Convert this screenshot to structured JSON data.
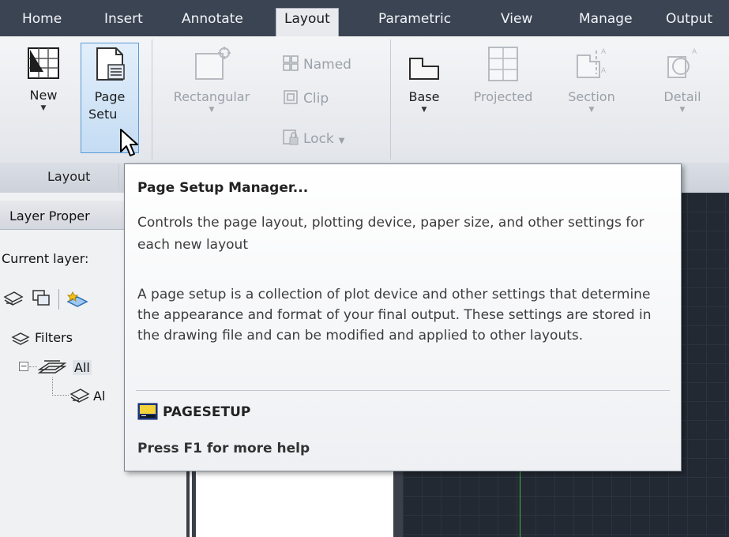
{
  "ribbon_tabs": [
    "Home",
    "Insert",
    "Annotate",
    "Layout",
    "Parametric",
    "View",
    "Manage",
    "Output"
  ],
  "active_tab": "Layout",
  "layout_panel": {
    "new_label": "New",
    "page_setup_label_1": "Page",
    "page_setup_label_2": "Setu",
    "panel_title": "Layout"
  },
  "viewport_panel": {
    "rectangular_label": "Rectangular",
    "named_label": "Named",
    "clip_label": "Clip",
    "lock_label": "Lock"
  },
  "create_view_panel": {
    "base_label": "Base",
    "projected_label": "Projected",
    "section_label": "Section",
    "detail_label": "Detail"
  },
  "palette": {
    "title": "Layer Proper",
    "current_layer": "Current layer:",
    "filters_label": "Filters",
    "tree_all": "All",
    "tree_all_used": "Al"
  },
  "tooltip": {
    "title": "Page Setup Manager...",
    "description": "Controls the page layout, plotting device, paper size, and other settings for each new layout",
    "extended": "A page setup is a collection of plot device and other settings that determine the appearance and format of your final output. These settings are stored in the drawing file and can be modified and applied to other layouts.",
    "command": "PAGESETUP",
    "help": "Press F1 for more help"
  },
  "colors": {
    "tab_bar": "#3b4453",
    "highlight": "#c5dcf3",
    "drawing_bg": "#232933",
    "ucs_green": "#3dbb3d"
  }
}
